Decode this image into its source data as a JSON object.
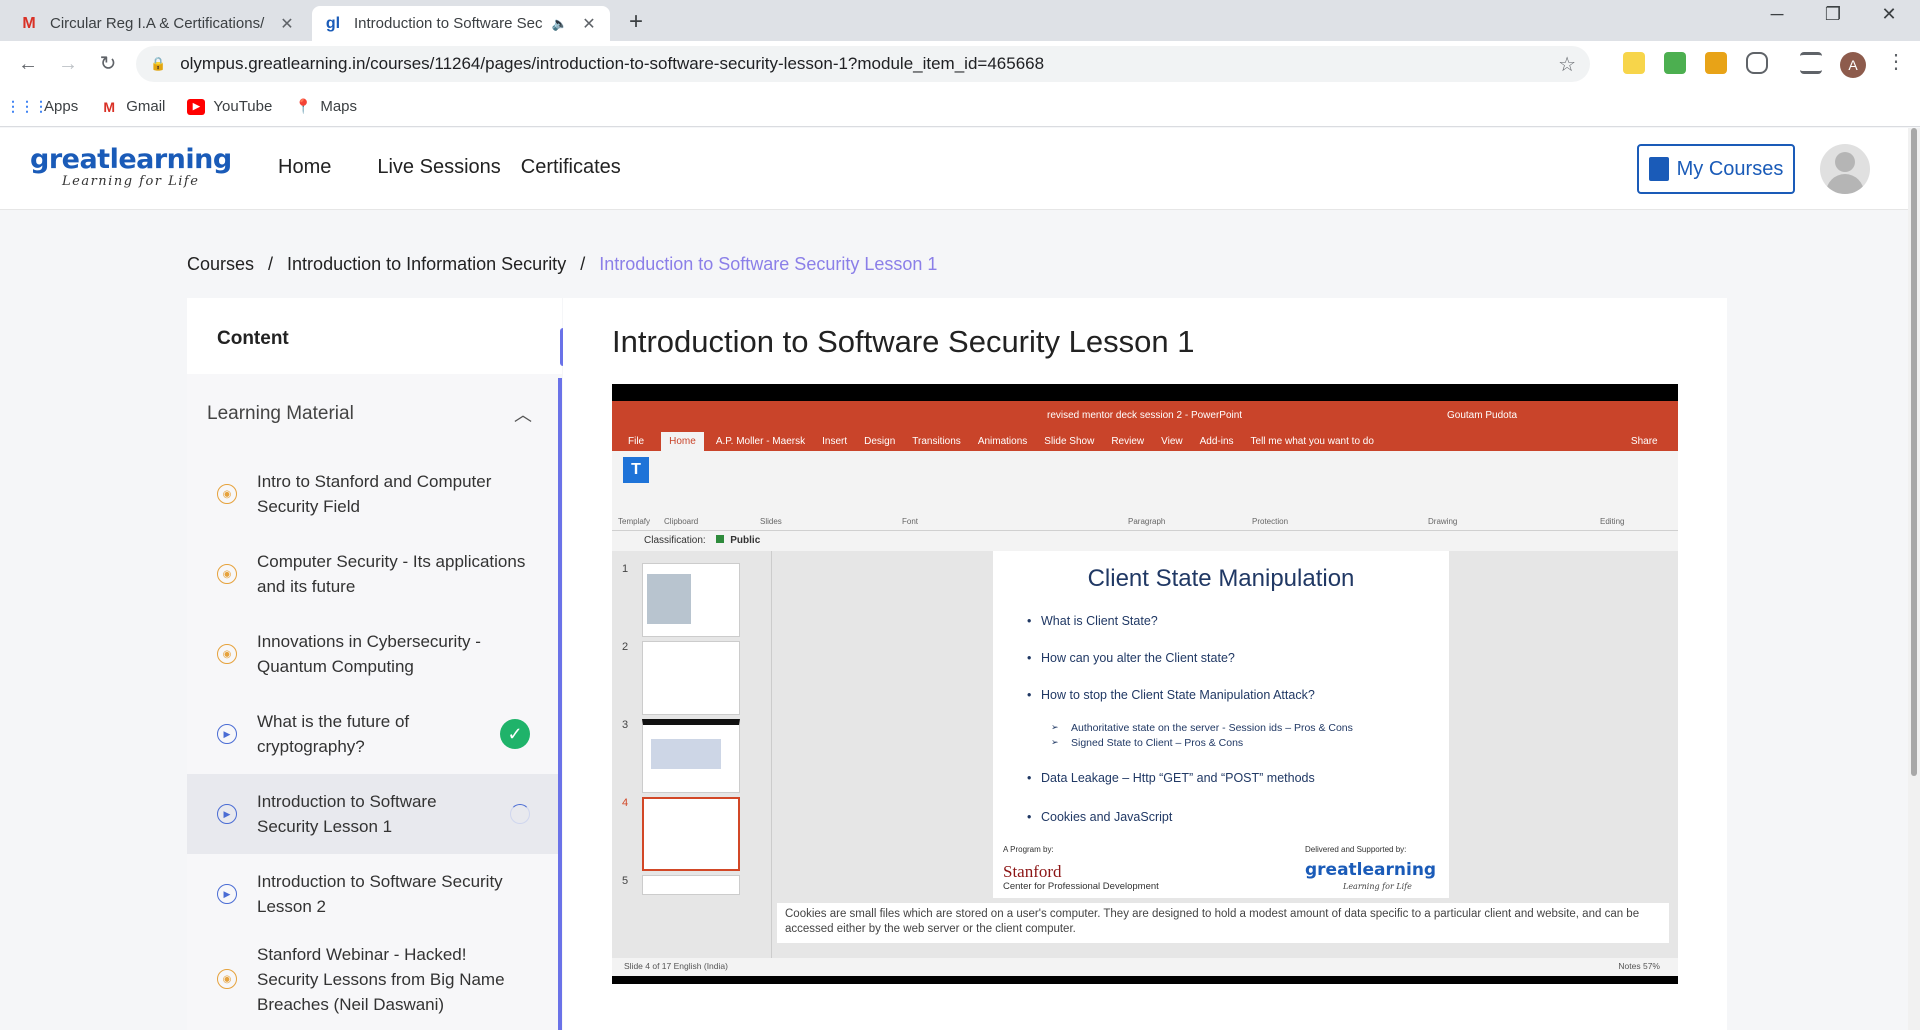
{
  "browser": {
    "tabs": [
      {
        "title": "Circular Reg I.A & Certifications/",
        "favicon": "gmail-icon",
        "active": false
      },
      {
        "title": "Introduction to Software Sec",
        "favicon": "greatlearning-icon",
        "active": true
      }
    ],
    "url": "olympus.greatlearning.in/courses/11264/pages/introduction-to-software-security-lesson-1?module_item_id=465668",
    "profile_initial": "A",
    "bookmarks": [
      "Apps",
      "Gmail",
      "YouTube",
      "Maps"
    ]
  },
  "site": {
    "logo_word": "greatlearning",
    "logo_tag": "Learning for Life",
    "nav": [
      "Home",
      "Live Sessions",
      "Certificates"
    ],
    "my_courses": "My Courses"
  },
  "breadcrumb": [
    "Courses",
    "Introduction to Information Security",
    "Introduction to Software Security Lesson 1"
  ],
  "sidebar": {
    "header": "Content",
    "section": "Learning Material",
    "items": [
      {
        "title": "Intro to Stanford and Computer Security Field",
        "type": "reading",
        "status": ""
      },
      {
        "title": "Computer Security - Its applications and its future",
        "type": "reading",
        "status": ""
      },
      {
        "title": "Innovations in Cybersecurity - Quantum Computing",
        "type": "reading",
        "status": ""
      },
      {
        "title": "What is the future of cryptography?",
        "type": "video",
        "status": "completed"
      },
      {
        "title": "Introduction to Software Security Lesson 1",
        "type": "video",
        "status": "in-progress"
      },
      {
        "title": "Introduction to Software Security Lesson 2",
        "type": "video",
        "status": ""
      },
      {
        "title": "Stanford Webinar - Hacked! Security Lessons from Big Name Breaches (Neil Daswani)",
        "type": "reading",
        "status": ""
      }
    ]
  },
  "lesson": {
    "title": "Introduction to Software Security Lesson 1"
  },
  "ppt": {
    "window_title": "revised mentor deck session 2 - PowerPoint",
    "user": "Goutam Pudota",
    "tabs": [
      "File",
      "Home",
      "A.P. Moller - Maersk",
      "Insert",
      "Design",
      "Transitions",
      "Animations",
      "Slide Show",
      "Review",
      "View",
      "Add-ins",
      "Tell me what you want to do",
      "Share"
    ],
    "groups": [
      "Templafy",
      "Clipboard",
      "Slides",
      "Font",
      "Paragraph",
      "Protection",
      "Drawing",
      "Editing"
    ],
    "classification_label": "Classification:",
    "classification_value": "Public",
    "slide_numbers": [
      "1",
      "2",
      "3",
      "4",
      "5"
    ],
    "slide": {
      "title": "Client State Manipulation",
      "bullets": [
        "What is Client State?",
        "How can you alter the Client state?",
        "How to stop the Client State Manipulation Attack?"
      ],
      "sub_bullets": [
        "Authoritative state on the server - Session ids – Pros & Cons",
        "Signed State to Client – Pros & Cons"
      ],
      "bullets2": [
        "Data Leakage – Http “GET” and “POST” methods",
        "Cookies and JavaScript"
      ],
      "program_by": "A Program by:",
      "stanford": "Stanford",
      "stanford_sub": "Center for Professional Development",
      "delivered_by": "Delivered and Supported by:",
      "gl": "greatlearning",
      "gl_tag": "Learning for Life"
    },
    "notes": "Cookies are small files which are stored on a user's computer. They are designed to hold a modest amount of data specific to a particular client and website, and can be accessed either by the web server or the client computer.",
    "status_left": "Slide 4 of 17    English (India)",
    "status_right": "Notes     57%"
  }
}
